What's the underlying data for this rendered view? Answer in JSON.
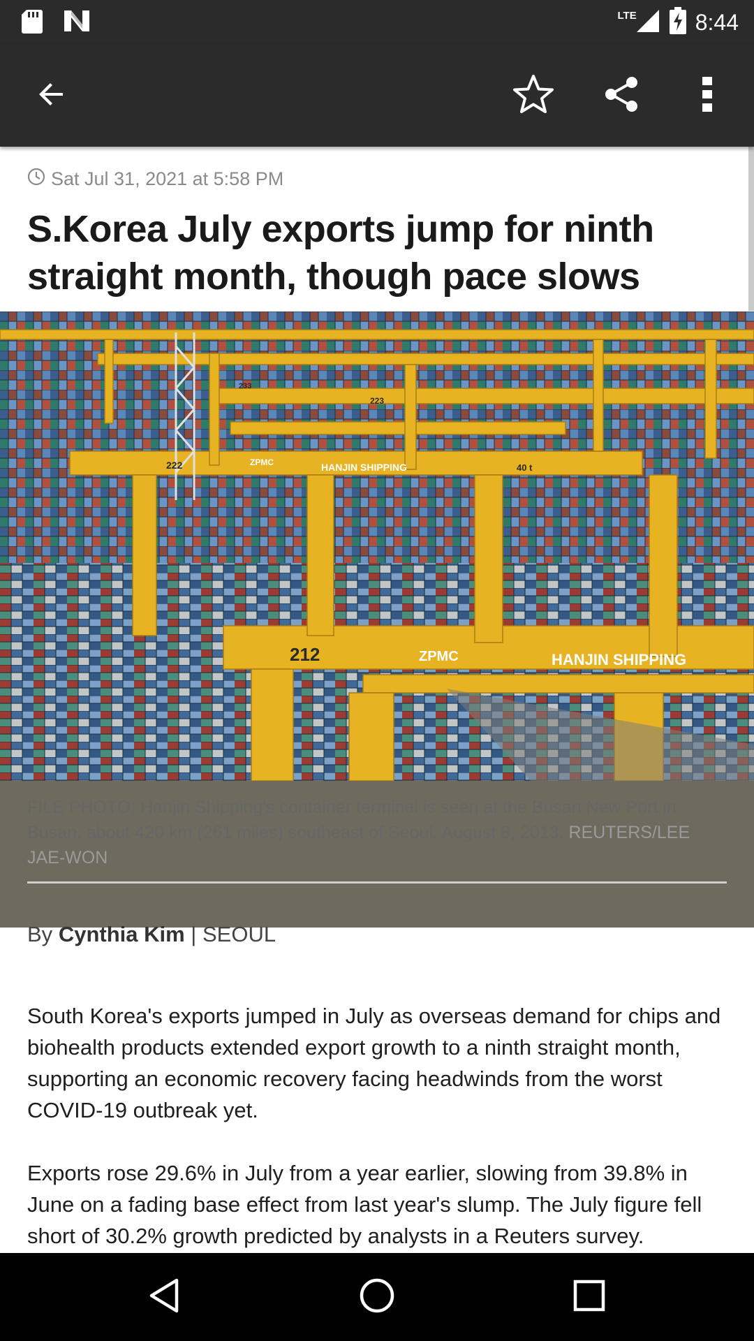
{
  "status_bar": {
    "time": "8:44",
    "network": "LTE",
    "left_icons": [
      "sd-card-icon",
      "n-logo-icon"
    ],
    "right_icons": [
      "signal-icon",
      "battery-charging-icon"
    ]
  },
  "app_bar": {
    "icons": [
      "back-arrow-icon",
      "star-outline-icon",
      "share-icon",
      "more-vert-icon"
    ]
  },
  "article": {
    "timestamp": "Sat Jul 31, 2021 at 5:58 PM",
    "headline": "S.Korea July exports jump for ninth straight month, though pace slows",
    "hero_image_labels": [
      "212",
      "222",
      "223",
      "233",
      "40 t",
      "ZPMC",
      "HANJIN SHIPPING"
    ],
    "caption": "FILE PHOTO: Hanjin Shipping's container terminal is seen at the Busan New Port in Busan, about 420 km (261 miles) southeast of Seoul, August 8, 2013.",
    "caption_credit": "REUTERS/LEE JAE-WON",
    "byline": {
      "prefix": "By",
      "author": "Cynthia Kim",
      "separator": "|",
      "location": "SEOUL"
    },
    "paragraphs": [
      "South Korea's exports jumped in July as overseas demand for chips and biohealth products extended export growth to a ninth straight month, supporting an economic recovery facing headwinds from the worst COVID-19 outbreak yet.",
      "Exports rose 29.6% in July from a year earlier, slowing from 39.8% in June on a fading base effect from last year's slump. The July figure fell short of 30.2% growth predicted by analysts in a Reuters survey."
    ]
  },
  "nav_bar": {
    "icons": [
      "nav-back-icon",
      "nav-home-icon",
      "nav-recents-icon"
    ]
  },
  "colors": {
    "bar_background": "#2b2b2b",
    "crane_yellow": "#e8b322",
    "text_primary": "#1a1a1a",
    "text_muted": "#8a8a8a"
  }
}
